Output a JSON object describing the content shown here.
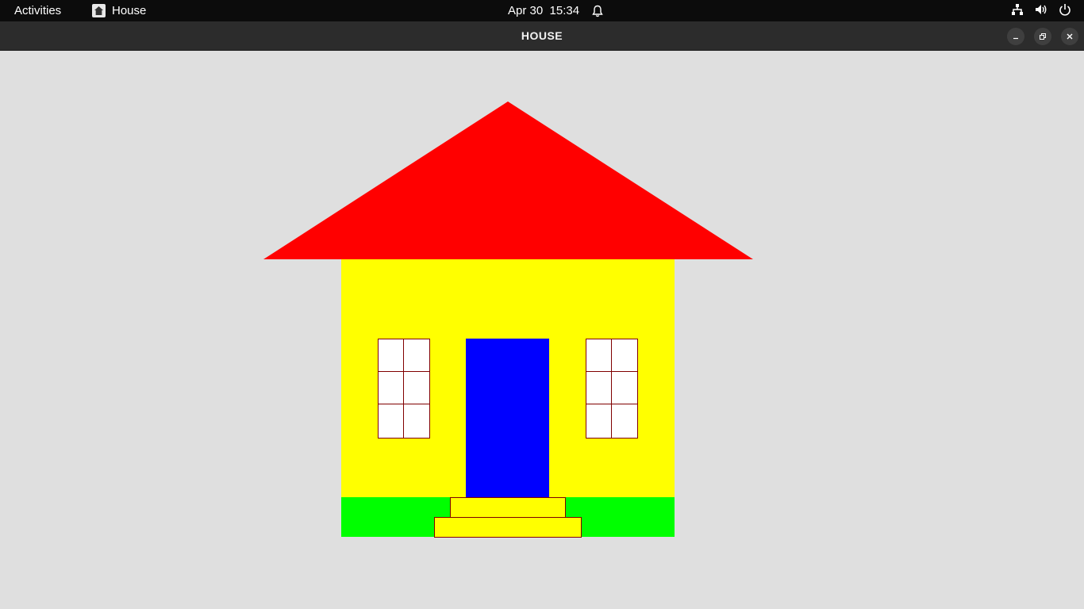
{
  "topbar": {
    "activities_label": "Activities",
    "app_name": "House",
    "app_icon": "house-app-icon",
    "date": "Apr 30",
    "time": "15:34",
    "tray_icons": [
      "network-icon",
      "volume-icon",
      "power-icon"
    ]
  },
  "window": {
    "title": "HOUSE",
    "controls": [
      "minimize-icon",
      "maximize-icon",
      "close-icon"
    ]
  },
  "drawing": {
    "colors": {
      "background": "#dfdfdf",
      "roof": "#ff0000",
      "wall": "#ffff00",
      "door": "#0000ff",
      "grass": "#00ff00",
      "window_pane": "#ffffff",
      "outline": "#800000",
      "steps": "#ffff00"
    }
  }
}
